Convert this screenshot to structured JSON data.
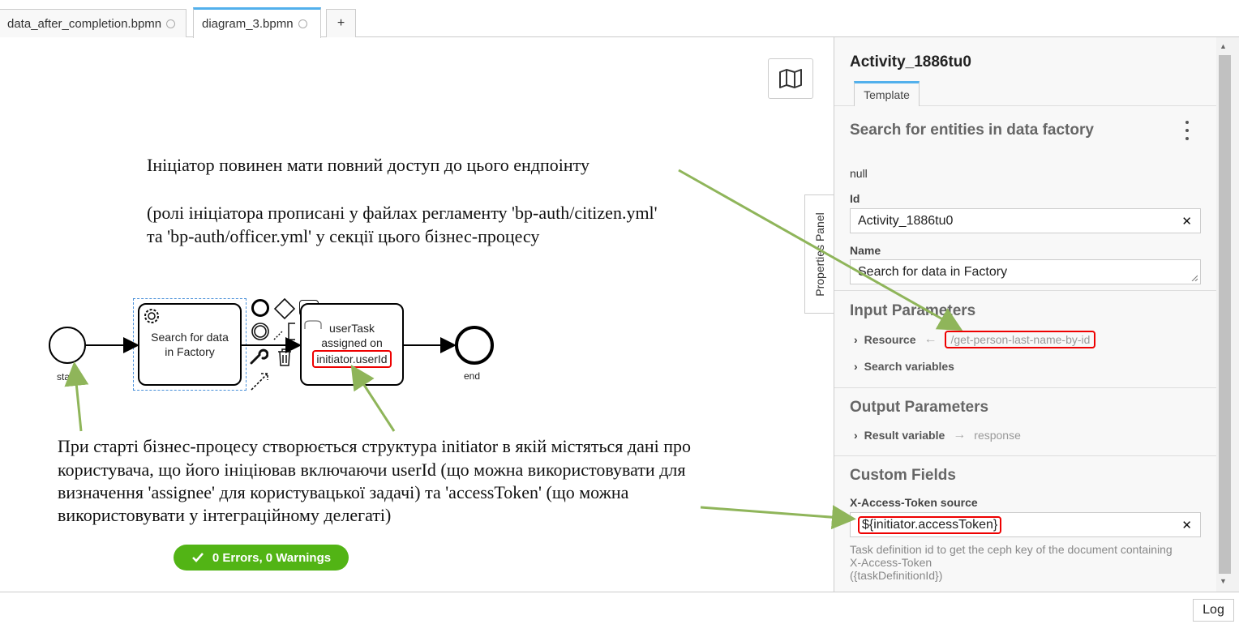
{
  "tabs": [
    {
      "label": "data_after_completion.bpmn"
    },
    {
      "label": "diagram_3.bpmn"
    },
    {
      "label": "+"
    }
  ],
  "annotations": {
    "top_line1": "Ініціатор повинен мати повний доступ до цього ендпоінту",
    "top_line2": "(ролі ініціатора прописані у файлах регламенту 'bp-auth/citizen.yml'",
    "top_line3": "та 'bp-auth/officer.yml' у секції цього бізнес-процесу",
    "bottom_line1": "При старті бізнес-процесу створюється структура initiator в якій містяться дані про",
    "bottom_line2": "користувача, що його ініціював включаючи userId (що можна використовувати для",
    "bottom_line3": "визначення 'assignee' для користувацької задачі) та 'accessToken' (що можна",
    "bottom_line4": "використовувати у інтеграційному делегаті)"
  },
  "diagram": {
    "start_label": "start",
    "end_label": "end",
    "service_task": "Search for data in Factory",
    "user_task_line1": "userTask",
    "user_task_line2": "assigned on",
    "user_task_line3": "initiator.userId"
  },
  "status": {
    "text": "0 Errors, 0 Warnings",
    "color": "#52b415"
  },
  "properties_toggle": "Properties Panel",
  "panel": {
    "title": "Activity_1886tu0",
    "tab": "Template",
    "template_name": "Search for entities in data factory",
    "null_text": "null",
    "id_label": "Id",
    "id_value": "Activity_1886tu0",
    "name_label": "Name",
    "name_value": "Search for data in Factory",
    "input_title": "Input Parameters",
    "resource_label": "Resource",
    "resource_value": "/get-person-last-name-by-id",
    "search_vars_label": "Search variables",
    "output_title": "Output Parameters",
    "result_label": "Result variable",
    "result_value": "response",
    "custom_title": "Custom Fields",
    "token_label": "X-Access-Token source",
    "token_value": "${initiator.accessToken}",
    "token_desc1": "Task definition id to get the ceph key of the document containing",
    "token_desc2": "X-Access-Token",
    "token_desc3": "({taskDefinitionId})"
  },
  "log_button": "Log",
  "colors": {
    "accent": "#52b0ec",
    "highlight": "#e00000",
    "arrow": "#8fb55a"
  }
}
